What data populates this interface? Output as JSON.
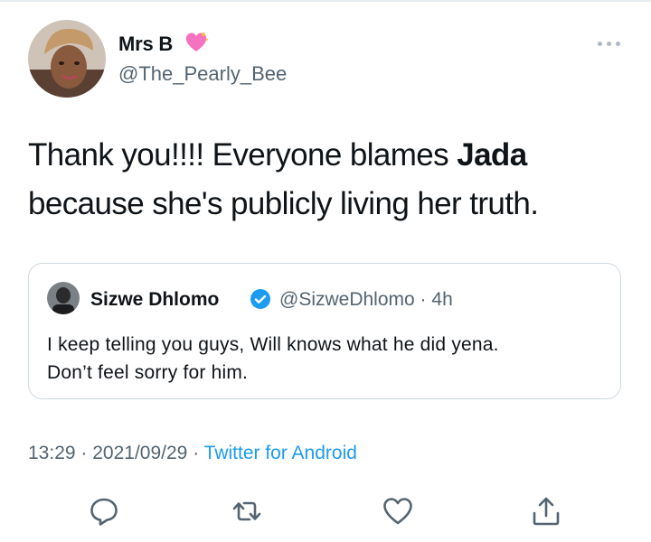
{
  "author": {
    "display_name": "Mrs B",
    "handle": "@The_Pearly_Bee"
  },
  "tweet": {
    "lines": [
      {
        "before": "Thank you!!!! Everyone blames ",
        "bold": "Jada"
      },
      {
        "before": "because she's publicly living her truth.",
        "bold": ""
      }
    ]
  },
  "quoted": {
    "name": "Sizwe Dhlomo",
    "handle": "@SizweDhlomo",
    "separator": "·",
    "age": "4h",
    "lines": [
      "I keep telling you guys, Will knows what he did yena.",
      "Don’t feel sorry for him."
    ]
  },
  "meta": {
    "time": "13:29",
    "separator": "·",
    "date": "2021/09/29",
    "source": "Twitter for Android"
  },
  "actions": [
    "reply-icon",
    "retweet-icon",
    "like-icon",
    "share-icon"
  ],
  "colors": {
    "text": "#0f1419",
    "secondary": "#536471",
    "accent": "#1d9bf0",
    "border": "#cfd9de",
    "heart_emoji": "#f472c0"
  }
}
